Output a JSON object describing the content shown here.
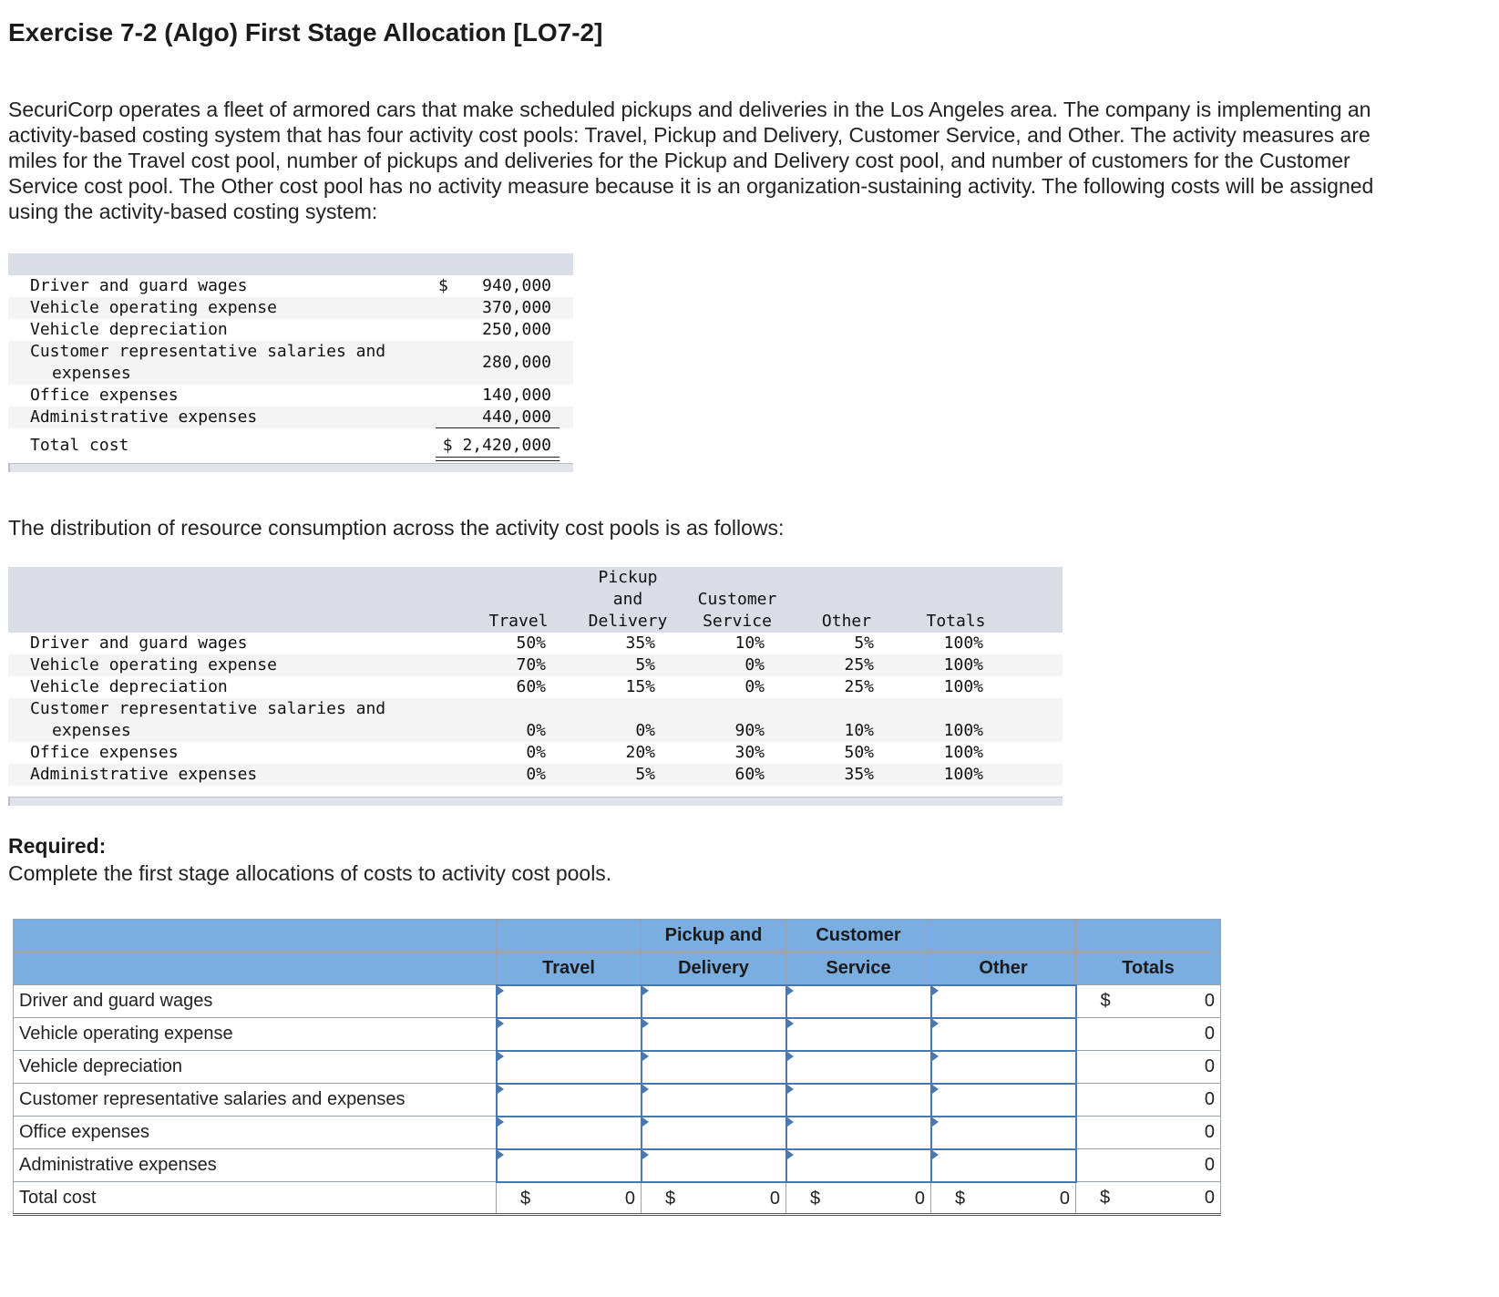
{
  "title": "Exercise 7-2 (Algo) First Stage Allocation [LO7-2]",
  "intro": "SecuriCorp operates a fleet of armored cars that make scheduled pickups and deliveries in the Los Angeles area. The company is implementing an activity-based costing system that has four activity cost pools: Travel, Pickup and Delivery, Customer Service, and Other. The activity measures are miles for the Travel cost pool, number of pickups and deliveries for the Pickup and Delivery cost pool, and number of customers for the Customer Service cost pool. The Other cost pool has no activity measure because it is an organization-sustaining activity. The following costs will be assigned using the activity-based costing system:",
  "costs": {
    "rows": [
      {
        "label": "Driver and guard wages",
        "dollar": "$",
        "amount": "940,000"
      },
      {
        "label": "Vehicle operating expense",
        "dollar": "",
        "amount": "370,000"
      },
      {
        "label": "Vehicle depreciation",
        "dollar": "",
        "amount": "250,000"
      },
      {
        "label_line1": "Customer representative salaries and",
        "label_line2": "expenses",
        "dollar": "",
        "amount": "280,000"
      },
      {
        "label": "Office expenses",
        "dollar": "",
        "amount": "140,000"
      },
      {
        "label": "Administrative expenses",
        "dollar": "",
        "amount": "440,000"
      }
    ],
    "total_label": "Total cost",
    "total_amount": "$ 2,420,000"
  },
  "distribution_intro": "The distribution of resource consumption across the activity cost pools is as follows:",
  "distribution": {
    "headers": {
      "travel": "Travel",
      "pickup_1": "Pickup",
      "pickup_2": "and",
      "pickup_3": "Delivery",
      "cs_1": "Customer",
      "cs_2": "Service",
      "other": "Other",
      "totals": "Totals"
    },
    "rows": [
      {
        "label": "Driver and guard wages",
        "travel": "50%",
        "pickup": "35%",
        "cs": "10%",
        "other": "5%",
        "total": "100%"
      },
      {
        "label": "Vehicle operating expense",
        "travel": "70%",
        "pickup": "5%",
        "cs": "0%",
        "other": "25%",
        "total": "100%"
      },
      {
        "label": "Vehicle depreciation",
        "travel": "60%",
        "pickup": "15%",
        "cs": "0%",
        "other": "25%",
        "total": "100%"
      },
      {
        "label_line1": "Customer representative salaries and",
        "label_line2": "expenses",
        "travel": "0%",
        "pickup": "0%",
        "cs": "90%",
        "other": "10%",
        "total": "100%"
      },
      {
        "label": "Office expenses",
        "travel": "0%",
        "pickup": "20%",
        "cs": "30%",
        "other": "50%",
        "total": "100%"
      },
      {
        "label": "Administrative expenses",
        "travel": "0%",
        "pickup": "5%",
        "cs": "60%",
        "other": "35%",
        "total": "100%"
      }
    ]
  },
  "required_label": "Required:",
  "required_text": "Complete the first stage allocations of costs to activity cost pools.",
  "answer": {
    "headers": {
      "travel": "Travel",
      "pickup_1": "Pickup and",
      "pickup_2": "Delivery",
      "cs_1": "Customer",
      "cs_2": "Service",
      "other": "Other",
      "totals": "Totals"
    },
    "rows": [
      {
        "label": "Driver and guard wages",
        "dollar": "$",
        "total": "0"
      },
      {
        "label": "Vehicle operating expense",
        "dollar": "",
        "total": "0"
      },
      {
        "label": "Vehicle depreciation",
        "dollar": "",
        "total": "0"
      },
      {
        "label": "Customer representative salaries and expenses",
        "dollar": "",
        "total": "0"
      },
      {
        "label": "Office expenses",
        "dollar": "",
        "total": "0"
      },
      {
        "label": "Administrative expenses",
        "dollar": "",
        "total": "0"
      }
    ],
    "total_row": {
      "label": "Total cost",
      "dollar": "$",
      "travel": "0",
      "pickup": "0",
      "cs": "0",
      "other": "0",
      "totals": "0"
    }
  }
}
